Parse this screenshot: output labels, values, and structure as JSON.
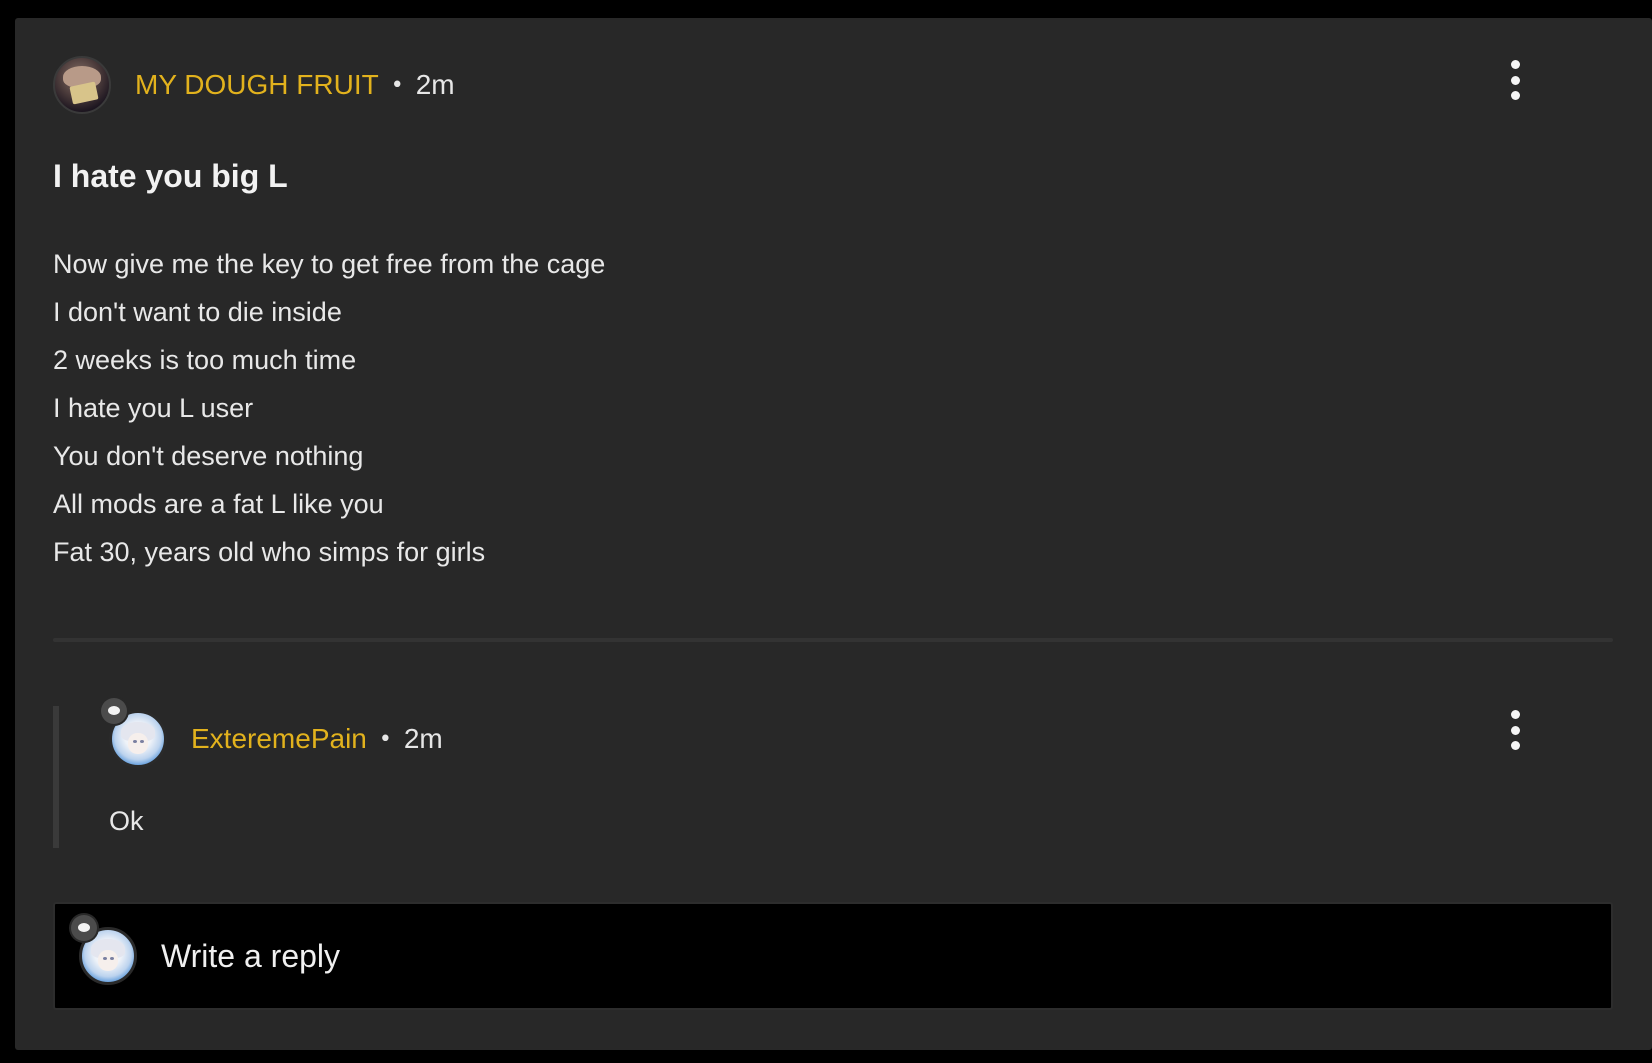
{
  "post": {
    "author": "MY DOUGH FRUIT",
    "separator": "•",
    "time": "2m",
    "title": "I hate you big L",
    "body_lines": [
      "Now give me the key to get free from the cage",
      "I don't want to die inside",
      "2 weeks is too much time",
      "I hate you L user",
      "You don't deserve nothing",
      "All mods are a fat L like you",
      "Fat 30, years old who simps for girls"
    ]
  },
  "reply": {
    "author": "ExteremePain",
    "separator": "•",
    "time": "2m",
    "text": "Ok"
  },
  "composer": {
    "placeholder": "Write a reply"
  },
  "colors": {
    "background": "#000000",
    "card": "#282828",
    "username": "#e2b21d",
    "text": "#e8e8e8"
  },
  "icons": {
    "post_menu": "more-vertical-icon",
    "reply_menu": "more-vertical-icon",
    "frame_badge": "chat-bubble-badge-icon"
  }
}
